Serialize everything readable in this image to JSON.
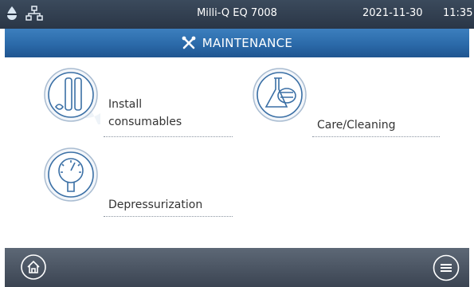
{
  "status": {
    "device_name": "Milli-Q EQ 7008",
    "date": "2021-11-30",
    "time": "11:35"
  },
  "header": {
    "title": "MAINTENANCE"
  },
  "tiles": [
    {
      "label_line1": "Install",
      "label_line2": "consumables"
    },
    {
      "label": "Care/Cleaning"
    },
    {
      "label": "Depressurization"
    }
  ],
  "colors": {
    "accent": "#2b6aa9",
    "statusbar": "#2a3646",
    "footer": "#4b5563",
    "icon_stroke": "#3a6fa5"
  },
  "icons": {
    "water_drop": "water-drop-icon",
    "network": "network-icon",
    "tools": "tools-icon",
    "home": "home-icon",
    "menu": "menu-icon"
  }
}
